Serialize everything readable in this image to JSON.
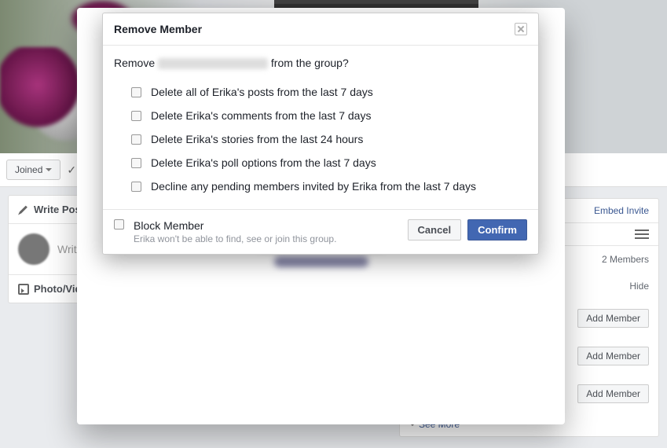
{
  "bg": {
    "joined_label": "Joined",
    "write_post": "Write Post",
    "photo_video": "Photo/Vide",
    "composer_prompt": "Write s",
    "embed_invite": "Embed Invite",
    "members_count": "2 Members",
    "hide": "Hide",
    "add_member": "Add Member",
    "see_more": "See More"
  },
  "modal": {
    "title": "Remove Member",
    "remove_prefix": "Remove",
    "remove_suffix": "from the group?",
    "options": [
      "Delete all of Erika's posts from the last 7 days",
      "Delete Erika's comments from the last 7 days",
      "Delete Erika's stories from the last 24 hours",
      "Delete Erika's poll options from the last 7 days",
      "Decline any pending members invited by Erika from the last 7 days"
    ],
    "block_title": "Block Member",
    "block_sub": "Erika won't be able to find, see or join this group.",
    "cancel": "Cancel",
    "confirm": "Confirm"
  }
}
